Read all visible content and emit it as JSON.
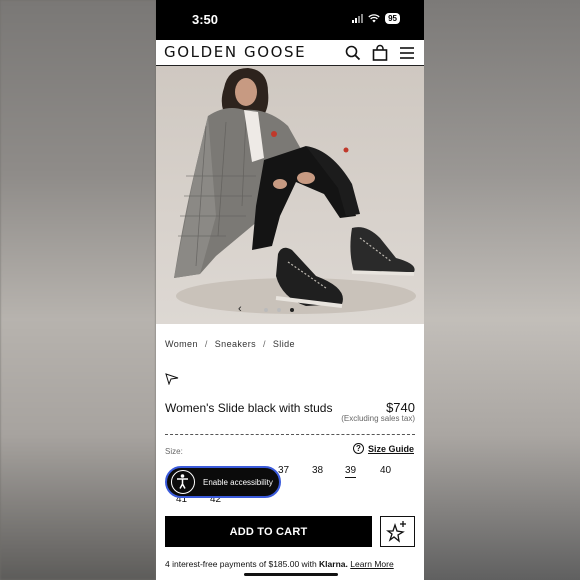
{
  "status_bar": {
    "time": "3:50",
    "battery": "95"
  },
  "header": {
    "brand": "GOLDEN GOOSE",
    "icons": [
      "search-icon",
      "bag-icon",
      "menu-icon"
    ]
  },
  "carousel": {
    "prev_arrow": "‹",
    "dot_count": 3,
    "active_dot": 3
  },
  "breadcrumb": {
    "items": [
      "Women",
      "Sneakers",
      "Slide"
    ],
    "separator": "/"
  },
  "product": {
    "title": "Women's Slide black with studs",
    "price": "$740",
    "tax_note": "(Excluding sales tax)"
  },
  "sizes": {
    "label": "Size:",
    "guide_icon": "?",
    "guide_label": "Size Guide",
    "options": [
      "37",
      "38",
      "39",
      "40",
      "41",
      "42"
    ],
    "selected": "39"
  },
  "accessibility": {
    "label": "Enable accessibility"
  },
  "cart": {
    "button_label": "ADD TO CART"
  },
  "klarna": {
    "prefix": "4 interest-free payments of $185.00 with",
    "brand": "Klarna.",
    "link": "Learn More"
  },
  "colors": {
    "primary": "#000000",
    "background": "#ffffff",
    "a11y_border": "#3b5bdb"
  }
}
